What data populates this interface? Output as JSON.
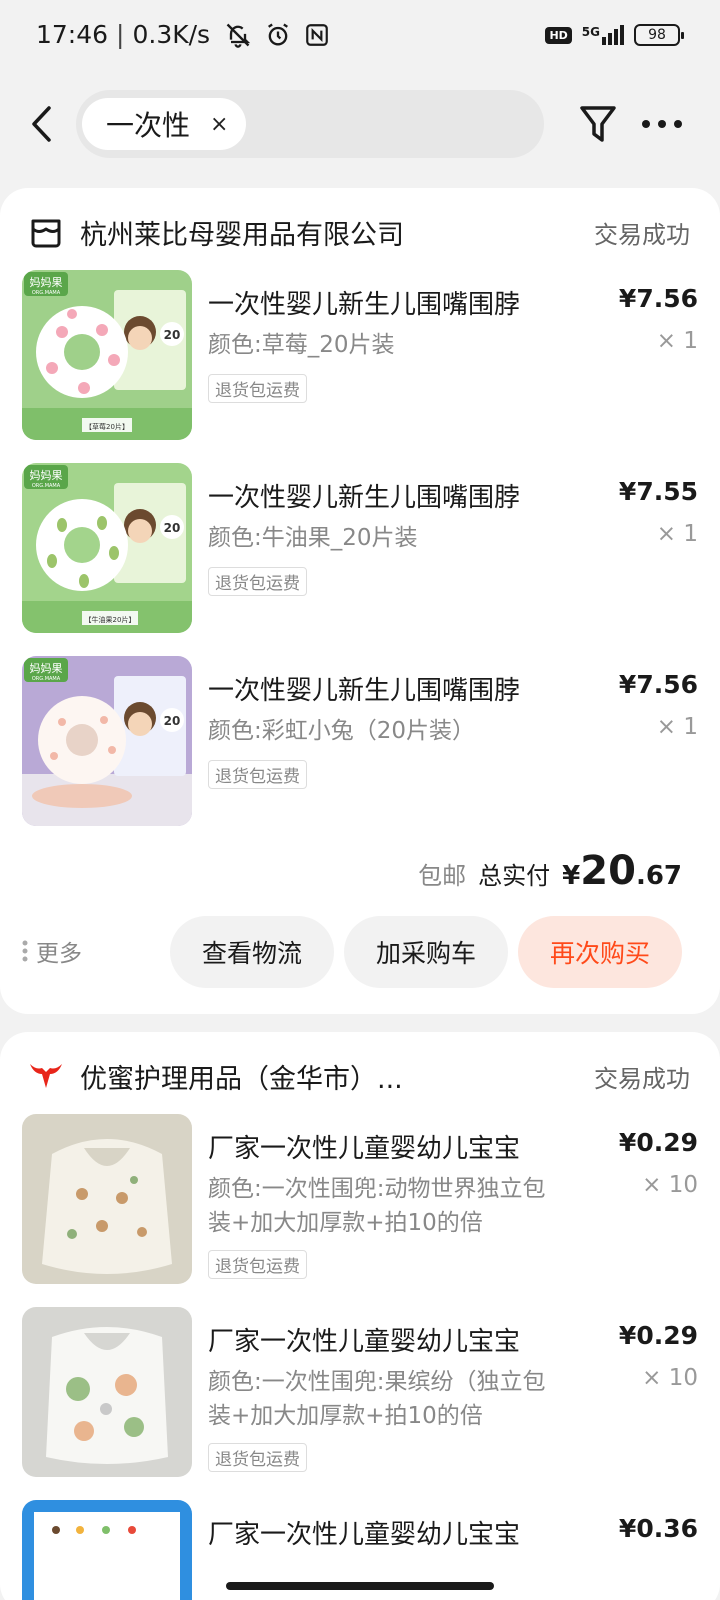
{
  "status_bar": {
    "time": "17:46",
    "net_speed": "0.3K/s",
    "hd": "HD",
    "network": "5G",
    "battery": "98"
  },
  "search": {
    "chip_text": "一次性",
    "chip_close": "×"
  },
  "orders": [
    {
      "shop_name": "杭州莱比母婴用品有限公司",
      "status": "交易成功",
      "items": [
        {
          "title": "一次性婴儿新生儿围嘴围脖",
          "variant": "颜色:草莓_20片装",
          "price": "¥7.56",
          "qty": "× 1",
          "tag": "退货包运费"
        },
        {
          "title": "一次性婴儿新生儿围嘴围脖",
          "variant": "颜色:牛油果_20片装",
          "price": "¥7.55",
          "qty": "× 1",
          "tag": "退货包运费"
        },
        {
          "title": "一次性婴儿新生儿围嘴围脖",
          "variant": "颜色:彩虹小兔（20片装）",
          "price": "¥7.56",
          "qty": "× 1",
          "tag": "退货包运费"
        }
      ],
      "free_shipping": "包邮",
      "total_label": "总实付",
      "total_currency": "¥",
      "total_int": "20",
      "total_dec": ".67",
      "more_label": "更多",
      "btn_logistics": "查看物流",
      "btn_cart": "加采购车",
      "btn_rebuy": "再次购买"
    },
    {
      "shop_name": "优蜜护理用品（金华市）...",
      "status": "交易成功",
      "items": [
        {
          "title": "厂家一次性儿童婴幼儿宝宝",
          "variant": "颜色:一次性围兜:动物世界独立包装+加大加厚款+拍10的倍",
          "price": "¥0.29",
          "qty": "× 10",
          "tag": "退货包运费"
        },
        {
          "title": "厂家一次性儿童婴幼儿宝宝",
          "variant": "颜色:一次性围兜:果缤纷（独立包装+加大加厚款+拍10的倍",
          "price": "¥0.29",
          "qty": "× 10",
          "tag": "退货包运费"
        },
        {
          "title": "厂家一次性儿童婴幼儿宝宝",
          "price": "¥0.36"
        }
      ]
    }
  ],
  "colors": {
    "accent": "#ff4a1a",
    "accent_bg": "#fde6de",
    "page_bg": "#f2f2f2",
    "shop2_logo": "#e8251a"
  },
  "product_images": [
    {
      "brand": "妈妈果",
      "brand_en": "ORG.MAMA",
      "badge": "20",
      "caption": "【草莓20片】"
    },
    {
      "brand": "妈妈果",
      "brand_en": "ORG.MAMA",
      "badge": "20",
      "caption": "【牛油果20片】"
    },
    {
      "brand": "妈妈果",
      "brand_en": "ORG.MAMA",
      "badge": "20"
    },
    {},
    {},
    {}
  ],
  "icons": [
    "back-icon",
    "filter-icon",
    "more-icon",
    "shop-icon",
    "bull-logo-icon",
    "vertical-dots-icon"
  ]
}
